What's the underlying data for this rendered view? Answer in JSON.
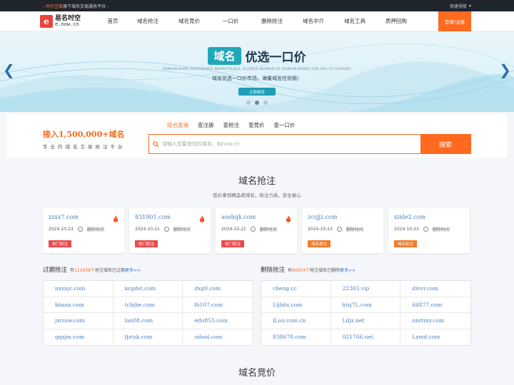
{
  "topbar": {
    "prefix": "- ",
    "brand": "时代互联",
    "rest": "旗下域名交易服务平台 -",
    "quick_nav": "快速导航"
  },
  "logo": {
    "cn": "易名时空",
    "en": "e.now.cn",
    "mark": "e"
  },
  "nav": {
    "items": [
      "首页",
      "域名抢注",
      "域名竞价",
      "一口价",
      "删除抢注",
      "域名中介",
      "域名工具",
      "质押回购"
    ],
    "login": "登录/注册"
  },
  "banner": {
    "tag": "域名",
    "slogan": "优选一口价",
    "en": "DOMAIN NAME PREFERENCE MARKETPLACE, A LARGE NUMBER OF DOMAIN NAMES FOR YOU TO CHOOSE!",
    "sub": "域名优选一口价市场，海量域名任你挑！",
    "button": "立即前往"
  },
  "search": {
    "promo": "接入1,500,000+域名",
    "promo_sub": "专业的域名交易抢注平台",
    "tabs": [
      "综合查询",
      "查注册",
      "查抢注",
      "查竞价",
      "查一口价"
    ],
    "placeholder": "请输入您要查找的域名，如now.cn",
    "button": "搜索"
  },
  "grab": {
    "title": "域名抢注",
    "subtitle": "低价拿到精品老域名，抢注力高，安全省心",
    "delete_label": "删除时间",
    "cards": [
      {
        "domain": "zzxx7.com",
        "date": "2024-10-23",
        "badge": "热门抢注",
        "kind": "hot"
      },
      {
        "domain": "831901.com",
        "date": "2024-10-21",
        "badge": "热门抢注",
        "kind": "hot"
      },
      {
        "domain": "asehqk.com",
        "date": "2024-10-21",
        "badge": "热门抢注",
        "kind": "hot"
      },
      {
        "domain": "zcsjjz.com",
        "date": "2024-10-23",
        "badge": "域名抢注",
        "kind": "pre"
      },
      {
        "domain": "xinle2.com",
        "date": "2024-10-23",
        "badge": "域名抢注",
        "kind": "pre"
      }
    ]
  },
  "expired": {
    "title": "过期抢注",
    "desc_pre": "有",
    "count": "112438个",
    "desc_post": "抢注域名已过期",
    "more": "更多>>",
    "domains": [
      "nxsnjc.com",
      "kcgdst.com",
      "dxg9.com",
      "bbaxx.com",
      "tchihe.com",
      "lh107.com",
      "jxrssw.com",
      "lan08.com",
      "edu855.com",
      "qqsjm.com",
      "fjztsk.com",
      "udool.com"
    ]
  },
  "deleted": {
    "title": "删除抢注",
    "desc_pre": "有",
    "count": "60054个",
    "desc_post": "抢注域名已删除",
    "more": "更多>>",
    "domains": [
      "cheng.cc",
      "22365.vip",
      "divvr.com",
      "Lijh6s.com",
      "kisj7L.com",
      "64877.com",
      "iLou.com.cn",
      "Ldjz.net",
      "nnrtmy.com",
      "838678.com",
      "021766.net",
      "Lzmd.com"
    ]
  },
  "auction": {
    "title": "域名竞价"
  }
}
